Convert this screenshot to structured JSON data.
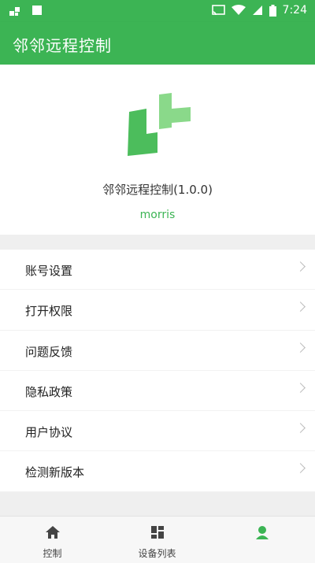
{
  "status_bar": {
    "time": "7:24",
    "icons": [
      "notification-icon",
      "square-icon",
      "cast-icon",
      "wifi-icon",
      "signal-icon",
      "battery-icon"
    ]
  },
  "app_bar": {
    "title": "邻邻远程控制"
  },
  "profile": {
    "logo_icon": "app-logo-icon",
    "app_name": "邻邻远程控制(1.0.0)",
    "username": "morris"
  },
  "menu": {
    "items": [
      {
        "label": "账号设置"
      },
      {
        "label": "打开权限"
      },
      {
        "label": "问题反馈"
      },
      {
        "label": "隐私政策"
      },
      {
        "label": "用户协议"
      },
      {
        "label": "检测新版本"
      }
    ]
  },
  "tabs": [
    {
      "label": "控制",
      "icon": "home-icon"
    },
    {
      "label": "设备列表",
      "icon": "grid-icon"
    },
    {
      "label": "",
      "icon": "profile-icon"
    }
  ],
  "colors": {
    "brand_green": "#3cb454",
    "logo_dark": "#4cbd5c",
    "logo_light": "#8ad98a"
  }
}
